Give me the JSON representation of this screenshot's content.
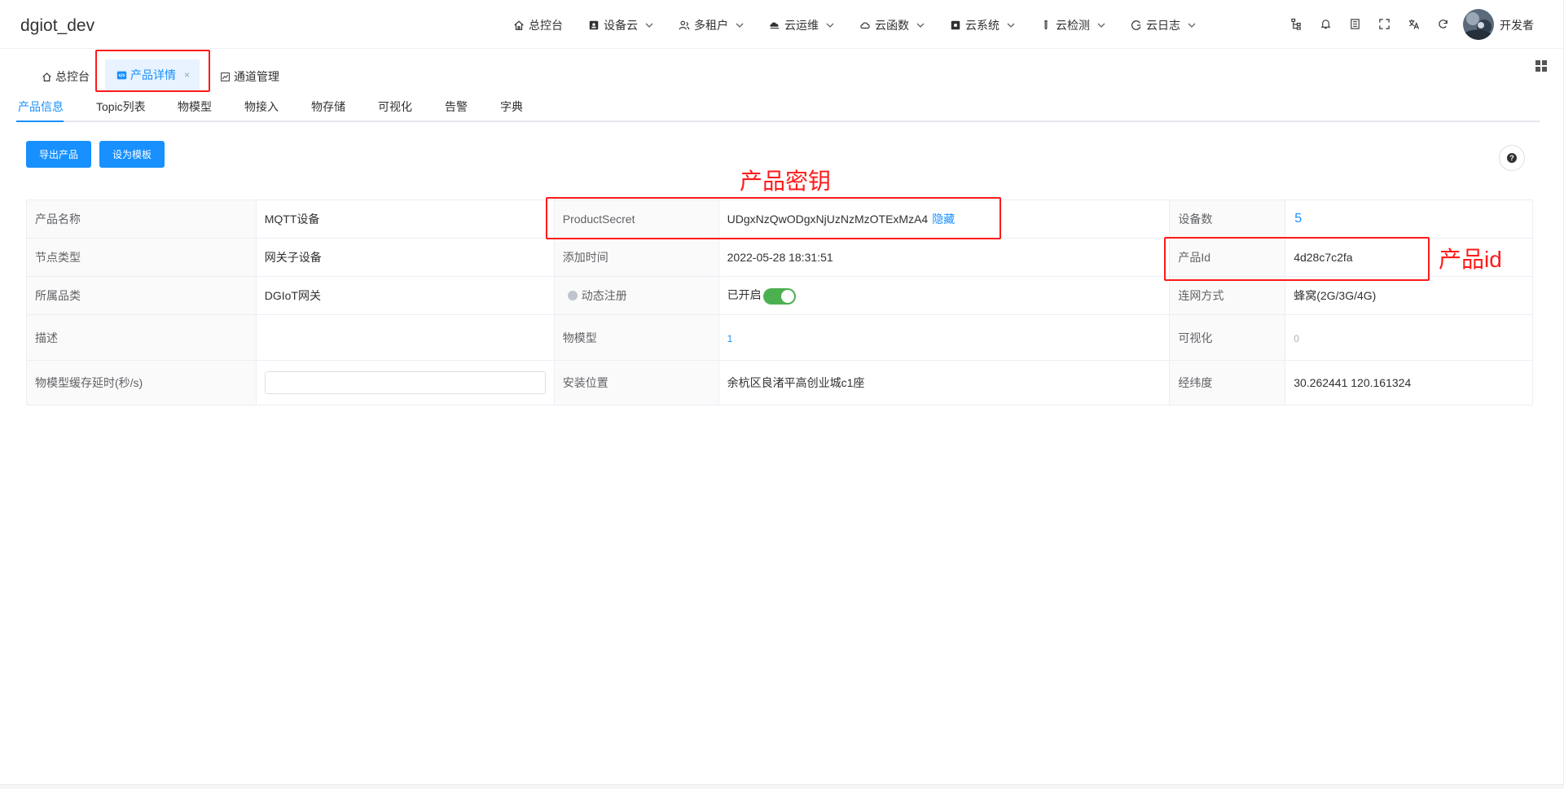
{
  "app": {
    "brand": "dgiot_dev"
  },
  "nav": {
    "items": [
      {
        "label": "总控台",
        "icon": "home-icon",
        "dropdown": false
      },
      {
        "label": "设备云",
        "icon": "device-cloud-icon",
        "dropdown": true
      },
      {
        "label": "多租户",
        "icon": "users-icon",
        "dropdown": true
      },
      {
        "label": "云运维",
        "icon": "cloud-ops-icon",
        "dropdown": true
      },
      {
        "label": "云函数",
        "icon": "cloud-function-icon",
        "dropdown": true
      },
      {
        "label": "云系统",
        "icon": "cloud-system-icon",
        "dropdown": true
      },
      {
        "label": "云检测",
        "icon": "test-tube-icon",
        "dropdown": true
      },
      {
        "label": "云日志",
        "icon": "log-icon",
        "dropdown": true
      }
    ],
    "tools": [
      "tree-icon",
      "bell-icon",
      "document-icon",
      "fullscreen-icon",
      "translate-icon",
      "refresh-icon"
    ],
    "user": "开发者"
  },
  "tags": {
    "home": "总控台",
    "product_detail": "产品详情",
    "channel": "通道管理",
    "close": "×"
  },
  "tabs": [
    "产品信息",
    "Topic列表",
    "物模型",
    "物接入",
    "物存储",
    "可视化",
    "告警",
    "字典"
  ],
  "actions": {
    "export": "导出产品",
    "template": "设为模板"
  },
  "info": {
    "product_name_label": "产品名称",
    "product_name": "MQTT设备",
    "secret_label": "ProductSecret",
    "secret": "UDgxNzQwODgxNjUzNzMzOTExMzA4",
    "hide": "隐藏",
    "device_count_label": "设备数",
    "device_count": "5",
    "node_type_label": "节点类型",
    "node_type": "网关子设备",
    "add_time_label": "添加时间",
    "add_time": "2022-05-28 18:31:51",
    "product_id_label": "产品Id",
    "product_id": "4d28c7c2fa",
    "category_label": "所属品类",
    "category": "DGIoT网关",
    "dynamic_reg_label": "动态注册",
    "dynamic_reg": "已开启",
    "network_label": "连网方式",
    "network": "蜂窝(2G/3G/4G)",
    "desc_label": "描述",
    "desc": "",
    "thing_model_label": "物模型",
    "thing_model": "1",
    "visual_label": "可视化",
    "visual": "0",
    "cache_label": "物模型缓存延时(秒/s)",
    "cache": "",
    "location_label": "安装位置",
    "location": "余杭区良渚平高创业城c1座",
    "lnglat_label": "经纬度",
    "lnglat": "30.262441 120.161324",
    "dynamic_reg_on": true
  },
  "annotations": {
    "secret": "产品密钥",
    "id": "产品id"
  },
  "colors": {
    "primary": "#1890ff",
    "annotation": "#ff1a1a",
    "success": "#20c030",
    "switch_on": "#4caf50"
  }
}
